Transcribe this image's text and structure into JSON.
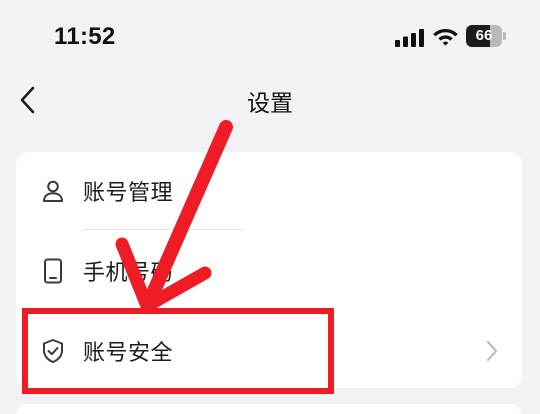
{
  "status_bar": {
    "time": "11:52",
    "battery_level": "66",
    "battery_fraction": 0.66,
    "icons": [
      "signal-icon",
      "wifi-icon",
      "battery-icon"
    ]
  },
  "nav": {
    "back_icon": "chevron-left-icon",
    "title": "设置"
  },
  "settings_list": {
    "items": [
      {
        "label": "账号管理",
        "icon": "user-icon"
      },
      {
        "label": "手机号码",
        "icon": "phone-icon"
      },
      {
        "label": "账号安全",
        "icon": "shield-icon",
        "chevron": "chevron-right-icon"
      }
    ]
  },
  "annotation": {
    "color": "#ee1c25",
    "highlighted_item": "账号安全"
  },
  "colors": {
    "background": "#f2f2f4",
    "card": "#ffffff",
    "text": "#1c1c1e",
    "icon": "#3a3a3c",
    "chevron": "#b5b5ba"
  }
}
